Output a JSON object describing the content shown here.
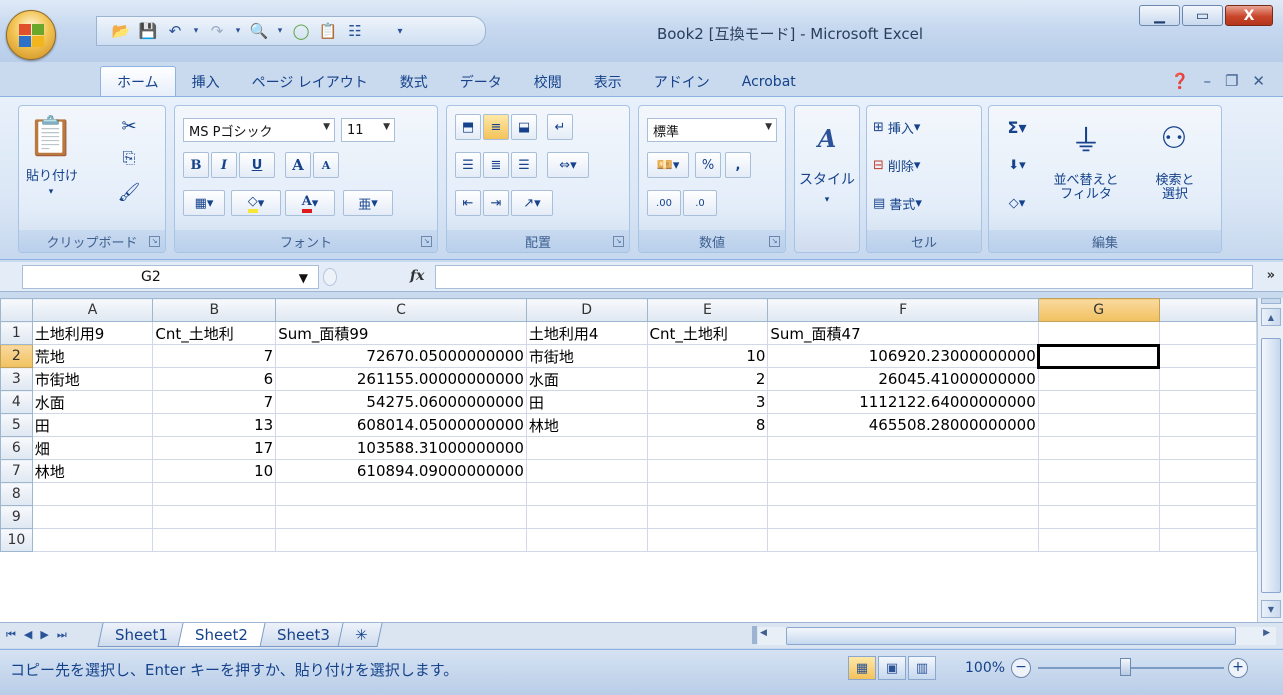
{
  "window": {
    "title": "Book2 [互換モード] - Microsoft Excel",
    "controls": {
      "minimize": "▁",
      "restore": "▭",
      "close": "X"
    }
  },
  "ribbon": {
    "tabs": [
      "ホーム",
      "挿入",
      "ページ レイアウト",
      "数式",
      "データ",
      "校閲",
      "表示",
      "アドイン",
      "Acrobat"
    ],
    "active_tab": "ホーム",
    "groups": {
      "clipboard": {
        "label": "クリップボード",
        "paste": "貼り付け"
      },
      "font": {
        "label": "フォント",
        "font_name": "MS Pゴシック",
        "font_size": "11",
        "bold": "B",
        "italic": "I",
        "underline": "U",
        "grow": "A",
        "shrink": "A",
        "color_a": "A",
        "phonetic": "亜"
      },
      "alignment": {
        "label": "配置"
      },
      "number": {
        "label": "数値",
        "format": "標準",
        "percent": "%",
        "comma": ",",
        "inc_decimal": ".00",
        "dec_decimal": ".0"
      },
      "styles": {
        "label": "スタイル"
      },
      "cells": {
        "label": "セル",
        "insert": "挿入",
        "delete": "削除",
        "format": "書式"
      },
      "editing": {
        "label": "編集",
        "sigma": "Σ",
        "sort_filter": "並べ替えと\nフィルタ",
        "find_select": "検索と\n選択"
      }
    }
  },
  "formula_bar": {
    "name_box": "G2",
    "fx": "fx",
    "value": ""
  },
  "grid": {
    "columns": [
      "A",
      "B",
      "C",
      "D",
      "E",
      "F",
      "G"
    ],
    "selected_column": "G",
    "rows": [
      {
        "n": "1",
        "cells": [
          "土地利用9",
          "Cnt_土地利",
          "Sum_面積99",
          "土地利用4",
          "Cnt_土地利",
          "Sum_面積47",
          ""
        ]
      },
      {
        "n": "2",
        "cells": [
          "荒地",
          "7",
          "72670.05000000000",
          "市街地",
          "10",
          "106920.23000000000",
          ""
        ]
      },
      {
        "n": "3",
        "cells": [
          "市街地",
          "6",
          "261155.00000000000",
          "水面",
          "2",
          "26045.41000000000",
          ""
        ]
      },
      {
        "n": "4",
        "cells": [
          "水面",
          "7",
          "54275.06000000000",
          "田",
          "3",
          "1112122.64000000000",
          ""
        ]
      },
      {
        "n": "5",
        "cells": [
          "田",
          "13",
          "608014.05000000000",
          "林地",
          "8",
          "465508.28000000000",
          ""
        ]
      },
      {
        "n": "6",
        "cells": [
          "畑",
          "17",
          "103588.31000000000",
          "",
          "",
          "",
          ""
        ]
      },
      {
        "n": "7",
        "cells": [
          "林地",
          "10",
          "610894.09000000000",
          "",
          "",
          "",
          ""
        ]
      },
      {
        "n": "8",
        "cells": [
          "",
          "",
          "",
          "",
          "",
          "",
          ""
        ]
      },
      {
        "n": "9",
        "cells": [
          "",
          "",
          "",
          "",
          "",
          "",
          ""
        ]
      },
      {
        "n": "10",
        "cells": [
          "",
          "",
          "",
          "",
          "",
          "",
          ""
        ]
      }
    ],
    "selected_cell": "G2"
  },
  "sheets": {
    "tabs": [
      "Sheet1",
      "Sheet2",
      "Sheet3"
    ],
    "active": "Sheet2"
  },
  "status": {
    "message": "コピー先を選択し、Enter キーを押すか、貼り付けを選択します。",
    "zoom": "100%"
  },
  "colors": {
    "ribbon_bg": "#dbe7f6",
    "header_sel": "#f1c15f",
    "accent": "#15428b"
  }
}
